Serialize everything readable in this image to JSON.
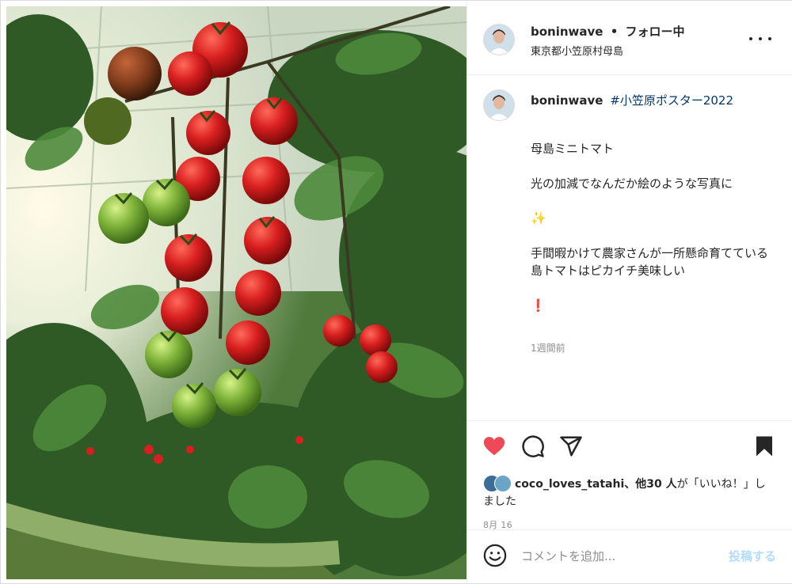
{
  "post": {
    "username": "boninwave",
    "separator": "•",
    "follow_status": "フォロー中",
    "location": "東京都小笠原村母島"
  },
  "caption": {
    "username": "boninwave",
    "hashtag": "#小笠原ポスター2022",
    "line1": "母島ミニトマト",
    "line2": "光の加減でなんだか絵のような写真に",
    "sparkle": "✨",
    "line3": "手間暇かけて農家さんが一所懸命育てている島トマトはピカイチ美味しい",
    "exclaim": "❗",
    "time": "1週間前"
  },
  "likes": {
    "user": "coco_loves_tatahi",
    "others": "、他30 人",
    "suffix": "が「いいね！」しました"
  },
  "post_date": "8月 16",
  "comment": {
    "placeholder": "コメントを追加...",
    "post_label": "投稿する"
  },
  "icons": {
    "more": "more-horizontal-icon",
    "like": "heart-icon",
    "comment": "comment-bubble-icon",
    "share": "paper-plane-icon",
    "save": "bookmark-icon",
    "emoji": "smiley-icon"
  },
  "colors": {
    "like_red": "#ed4956",
    "hashtag_blue": "#00376b",
    "post_button_disabled": "#b3dbff",
    "secondary_text": "#8e8e8e"
  }
}
